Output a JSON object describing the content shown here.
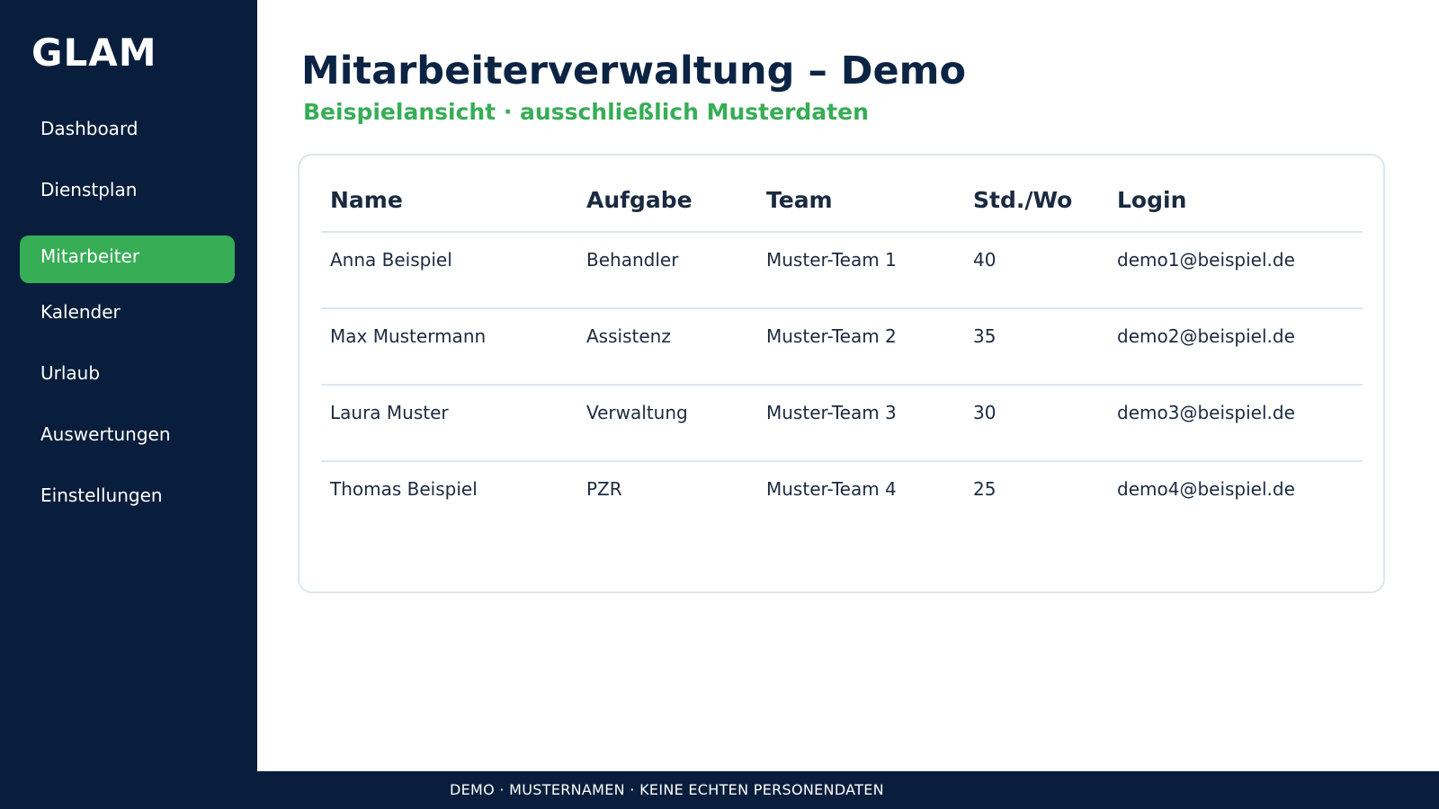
{
  "sidebar": {
    "brand": "GLAM",
    "items": [
      {
        "label": "Dashboard",
        "active": false
      },
      {
        "label": "Dienstplan",
        "active": false
      },
      {
        "label": "Mitarbeiter",
        "active": true
      },
      {
        "label": "Kalender",
        "active": false
      },
      {
        "label": "Urlaub",
        "active": false
      },
      {
        "label": "Auswertungen",
        "active": false
      },
      {
        "label": "Einstellungen",
        "active": false
      }
    ]
  },
  "main": {
    "title": "Mitarbeiterverwaltung – Demo",
    "subtitle": "Beispielansicht · ausschließlich Musterdaten"
  },
  "table": {
    "columns": [
      "Name",
      "Aufgabe",
      "Team",
      "Std./Wo",
      "Login"
    ],
    "rows": [
      [
        "Anna Beispiel",
        "Behandler",
        "Muster-Team 1",
        "40",
        "demo1@beispiel.de"
      ],
      [
        "Max Mustermann",
        "Assistenz",
        "Muster-Team 2",
        "35",
        "demo2@beispiel.de"
      ],
      [
        "Laura Muster",
        "Verwaltung",
        "Muster-Team 3",
        "30",
        "demo3@beispiel.de"
      ],
      [
        "Thomas Beispiel",
        "PZR",
        "Muster-Team 4",
        "25",
        "demo4@beispiel.de"
      ]
    ]
  },
  "footer": {
    "text": "DEMO · MUSTERNAMEN · KEINE ECHTEN PERSONENDATEN"
  },
  "colors": {
    "sidebar_bg": "#081e3c",
    "accent": "#37ad56",
    "title": "#0c2444"
  }
}
